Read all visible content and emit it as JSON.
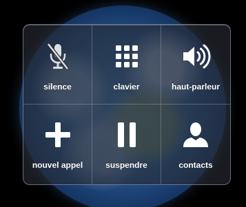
{
  "call_controls": {
    "buttons": [
      {
        "label": "silence",
        "icon": "mute-icon"
      },
      {
        "label": "clavier",
        "icon": "keypad-icon"
      },
      {
        "label": "haut-parleur",
        "icon": "speaker-icon"
      },
      {
        "label": "nouvel appel",
        "icon": "add-call-icon"
      },
      {
        "label": "suspendre",
        "icon": "hold-icon"
      },
      {
        "label": "contacts",
        "icon": "contacts-icon"
      }
    ]
  },
  "colors": {
    "icon": "#ffffff",
    "muted_icon": "#e8e8e8",
    "panel_border": "#aab4c3"
  }
}
